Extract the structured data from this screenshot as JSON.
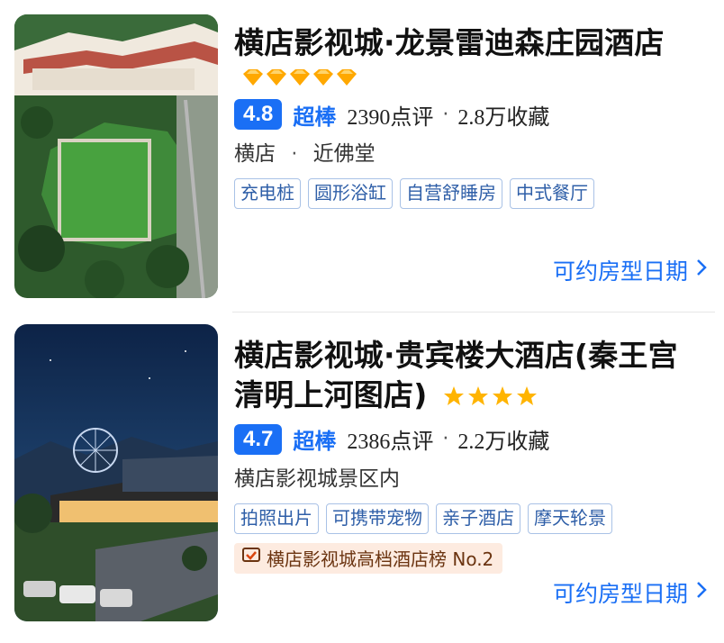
{
  "hotels": [
    {
      "name": "横店影视城·龙景雷迪森庄园酒店",
      "diamonds": 5,
      "score": "4.8",
      "score_word": "超棒",
      "reviews": "2390点评",
      "separator": "·",
      "favorites": "2.8万收藏",
      "location_area": "横店",
      "location_near": "近佛堂",
      "tags": [
        "充电桩",
        "圆形浴缸",
        "自营舒睡房",
        "中式餐厅"
      ],
      "cta": "可约房型日期"
    },
    {
      "name": "横店影视城·贵宾楼大酒店(秦王宫清明上河图店)",
      "name_line1": "横店影视城·贵宾楼大酒店(秦王宫",
      "name_line2": "清明上河图店)",
      "stars": 4,
      "score": "4.7",
      "score_word": "超棒",
      "reviews": "2386点评",
      "separator": "·",
      "favorites": "2.2万收藏",
      "location": "横店影视城景区内",
      "tags": [
        "拍照出片",
        "可携带宠物",
        "亲子酒店",
        "摩天轮景"
      ],
      "rank": "横店影视城高档酒店榜 No.2",
      "cta": "可约房型日期"
    }
  ],
  "icons": {
    "cta_chevron": "chevron-right-icon",
    "rank_icon": "trophy-icon",
    "diamond": "diamond-icon",
    "star": "star-icon"
  },
  "colors": {
    "accent": "#1a6ff5",
    "diamond": "#ffa800",
    "star": "#ffb400",
    "tag_border": "#a9c2e6",
    "tag_text": "#2f5fa8",
    "rank_bg": "#fdebe0"
  }
}
